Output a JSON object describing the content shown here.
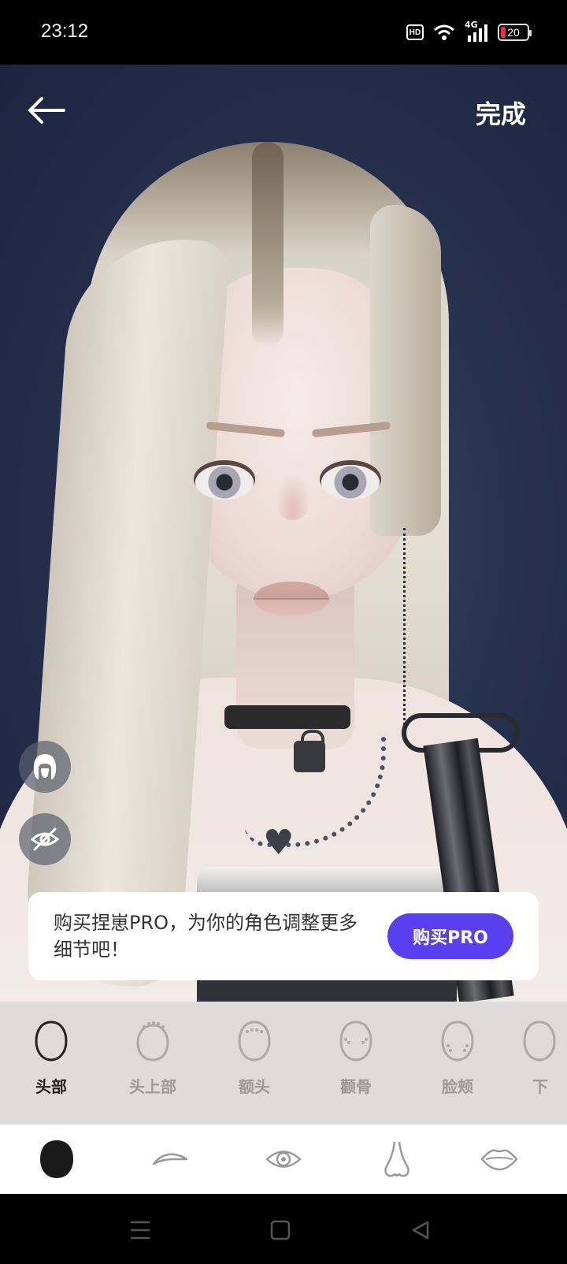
{
  "status_bar": {
    "time": "23:12",
    "hd_label": "HD",
    "network": "4G",
    "battery_level": "20",
    "icons": [
      "hd-icon",
      "wifi-icon",
      "signal-icon",
      "battery-icon"
    ]
  },
  "header": {
    "back_icon": "back-arrow-icon",
    "done_label": "完成"
  },
  "floating_buttons": [
    {
      "icon": "hair-icon"
    },
    {
      "icon": "eye-hidden-icon"
    }
  ],
  "promo": {
    "text": "购买捏崽PRO，为你的角色调整更多细节吧！",
    "button_label": "购买PRO",
    "button_color": "#5a3ff0"
  },
  "sub_tabs": [
    {
      "label": "头部",
      "icon": "head-outline-icon",
      "active": true
    },
    {
      "label": "头上部",
      "icon": "head-top-icon",
      "active": false
    },
    {
      "label": "额头",
      "icon": "forehead-icon",
      "active": false
    },
    {
      "label": "颧骨",
      "icon": "cheekbone-icon",
      "active": false
    },
    {
      "label": "脸颊",
      "icon": "cheek-icon",
      "active": false
    },
    {
      "label": "下",
      "icon": "jaw-icon",
      "active": false
    }
  ],
  "main_tabs": [
    {
      "icon": "face-icon",
      "active": true
    },
    {
      "icon": "eyebrow-icon",
      "active": false
    },
    {
      "icon": "eye-icon",
      "active": false
    },
    {
      "icon": "nose-icon",
      "active": false
    },
    {
      "icon": "lips-icon",
      "active": false
    }
  ],
  "nav_bar": {
    "icons": [
      "menu-icon",
      "home-icon",
      "back-icon"
    ]
  }
}
